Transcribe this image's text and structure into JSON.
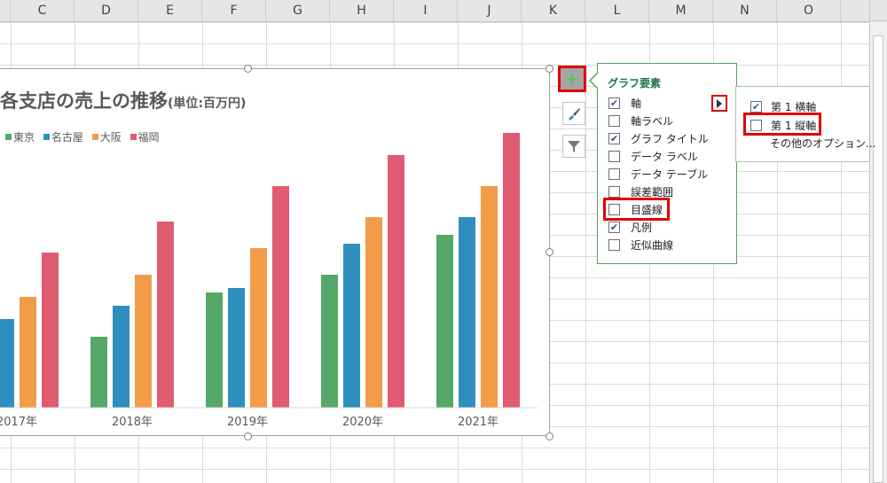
{
  "columns": [
    "C",
    "D",
    "E",
    "F",
    "G",
    "H",
    "I",
    "J",
    "K",
    "L",
    "M",
    "N",
    "O"
  ],
  "chart_data": {
    "type": "bar",
    "title": "各支店の売上の推移",
    "subtitle": "(単位:百万円)",
    "categories": [
      "2017年",
      "2018年",
      "2019年",
      "2020年",
      "2021年"
    ],
    "series": [
      {
        "name": "東京",
        "color": "#55a868",
        "values": [
          null,
          80,
          130,
          150,
          195
        ]
      },
      {
        "name": "名古屋",
        "color": "#2e8fbf",
        "values": [
          100,
          115,
          135,
          185,
          215
        ]
      },
      {
        "name": "大阪",
        "color": "#f39c48",
        "values": [
          125,
          150,
          180,
          215,
          250
        ]
      },
      {
        "name": "福岡",
        "color": "#e05a72",
        "values": [
          175,
          210,
          250,
          285,
          310
        ]
      }
    ],
    "ylim": [
      0,
      320
    ],
    "grid": false,
    "legend": "top-left"
  },
  "panel": {
    "title": "グラフ要素",
    "options": [
      {
        "label": "軸",
        "checked": true
      },
      {
        "label": "軸ラベル",
        "checked": false
      },
      {
        "label": "グラフ タイトル",
        "checked": true
      },
      {
        "label": "データ ラベル",
        "checked": false
      },
      {
        "label": "データ テーブル",
        "checked": false
      },
      {
        "label": "誤差範囲",
        "checked": false
      },
      {
        "label": "目盛線",
        "checked": false
      },
      {
        "label": "凡例",
        "checked": true
      },
      {
        "label": "近似曲線",
        "checked": false
      }
    ]
  },
  "axis_menu": {
    "primary_horizontal": "第 1 横軸",
    "primary_vertical": "第 1 縦軸",
    "more_options": "その他のオプション..."
  },
  "icons": {
    "plus": "+",
    "check": "✔"
  },
  "colors": {
    "highlight": "#e00000",
    "panel_title": "#217346"
  }
}
